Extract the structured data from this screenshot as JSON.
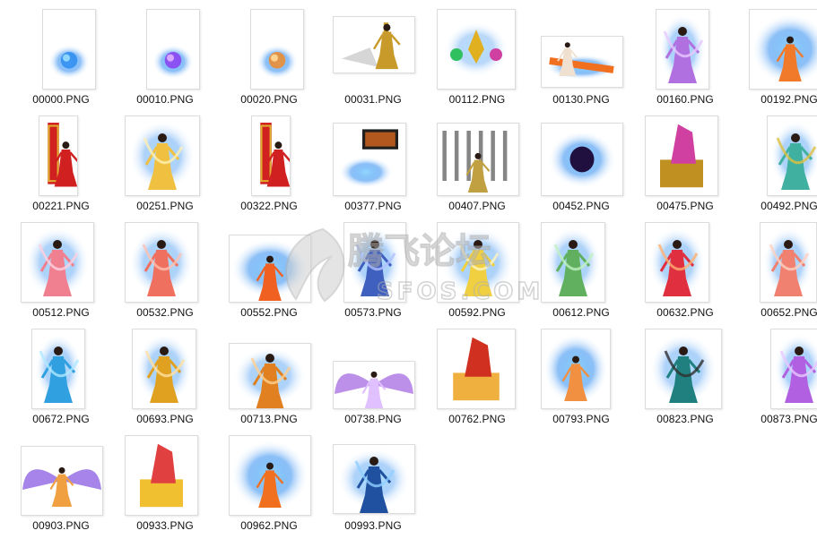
{
  "files": [
    {
      "name": "00000.PNG",
      "art": "orb",
      "c1": "#2f8cf0",
      "c2": "#8fd6ff"
    },
    {
      "name": "00010.PNG",
      "art": "orb",
      "c1": "#8c3cf0",
      "c2": "#d7a8ff"
    },
    {
      "name": "00020.PNG",
      "art": "orb",
      "c1": "#f08a2a",
      "c2": "#ffd28f"
    },
    {
      "name": "00031.PNG",
      "art": "shadowfig",
      "c1": "#c89a2a",
      "c2": "#8a8a8a"
    },
    {
      "name": "00112.PNG",
      "art": "gems",
      "c1": "#e0b020",
      "c2": "#d040a0"
    },
    {
      "name": "00130.PNG",
      "art": "wide",
      "c1": "#f07020",
      "c2": "#f0c040"
    },
    {
      "name": "00160.PNG",
      "art": "figure",
      "c1": "#b070e0",
      "c2": "#e8c8ff"
    },
    {
      "name": "00192.PNG",
      "art": "fire",
      "c1": "#f07a2a",
      "c2": "#ffd0a0"
    },
    {
      "name": "00221.PNG",
      "art": "banner",
      "c1": "#d02020",
      "c2": "#e0b030"
    },
    {
      "name": "00251.PNG",
      "art": "figure",
      "c1": "#f0c040",
      "c2": "#fff0b0"
    },
    {
      "name": "00322.PNG",
      "art": "banner",
      "c1": "#d02020",
      "c2": "#e0b030"
    },
    {
      "name": "00377.PNG",
      "art": "flag",
      "c1": "#f07020",
      "c2": "#202020"
    },
    {
      "name": "00407.PNG",
      "art": "scroll",
      "c1": "#c0a040",
      "c2": "#202020"
    },
    {
      "name": "00452.PNG",
      "art": "portal",
      "c1": "#6030c0",
      "c2": "#c090ff"
    },
    {
      "name": "00475.PNG",
      "art": "throne",
      "c1": "#d040a0",
      "c2": "#c09020"
    },
    {
      "name": "00492.PNG",
      "art": "figure",
      "c1": "#40b0a0",
      "c2": "#e0c040"
    },
    {
      "name": "00512.PNG",
      "art": "figure",
      "c1": "#f08090",
      "c2": "#ffd0e0"
    },
    {
      "name": "00532.PNG",
      "art": "figure",
      "c1": "#f07060",
      "c2": "#ffc0b0"
    },
    {
      "name": "00552.PNG",
      "art": "fire",
      "c1": "#f06020",
      "c2": "#ffc080"
    },
    {
      "name": "00573.PNG",
      "art": "figure",
      "c1": "#4060c0",
      "c2": "#b0c0ff"
    },
    {
      "name": "00592.PNG",
      "art": "figure",
      "c1": "#f0d040",
      "c2": "#fff4c0"
    },
    {
      "name": "00612.PNG",
      "art": "figure",
      "c1": "#60b060",
      "c2": "#c0f0c0"
    },
    {
      "name": "00632.PNG",
      "art": "figure",
      "c1": "#e03040",
      "c2": "#ffb070"
    },
    {
      "name": "00652.PNG",
      "art": "figure",
      "c1": "#f08070",
      "c2": "#ffd0c0"
    },
    {
      "name": "00672.PNG",
      "art": "figure",
      "c1": "#30a0e0",
      "c2": "#b0e8ff"
    },
    {
      "name": "00693.PNG",
      "art": "figure",
      "c1": "#e0a020",
      "c2": "#ffe0a0"
    },
    {
      "name": "00713.PNG",
      "art": "figure",
      "c1": "#e08020",
      "c2": "#ffd090"
    },
    {
      "name": "00738.PNG",
      "art": "wings",
      "c1": "#a060e0",
      "c2": "#e0c0ff"
    },
    {
      "name": "00762.PNG",
      "art": "throne",
      "c1": "#d03020",
      "c2": "#f0b040"
    },
    {
      "name": "00793.PNG",
      "art": "fire",
      "c1": "#f09040",
      "c2": "#ffe0c0"
    },
    {
      "name": "00823.PNG",
      "art": "figure",
      "c1": "#208080",
      "c2": "#303030"
    },
    {
      "name": "00873.PNG",
      "art": "figure",
      "c1": "#b060e0",
      "c2": "#e8c8ff"
    },
    {
      "name": "00903.PNG",
      "art": "wings",
      "c1": "#8050e0",
      "c2": "#f0a040"
    },
    {
      "name": "00933.PNG",
      "art": "throne",
      "c1": "#e04040",
      "c2": "#f0c030"
    },
    {
      "name": "00962.PNG",
      "art": "fire",
      "c1": "#f07020",
      "c2": "#ffd080"
    },
    {
      "name": "00993.PNG",
      "art": "figure",
      "c1": "#2050a0",
      "c2": "#90d0ff"
    }
  ],
  "watermark": {
    "main": "腾飞论坛",
    "sub": "SFOS.COM"
  }
}
